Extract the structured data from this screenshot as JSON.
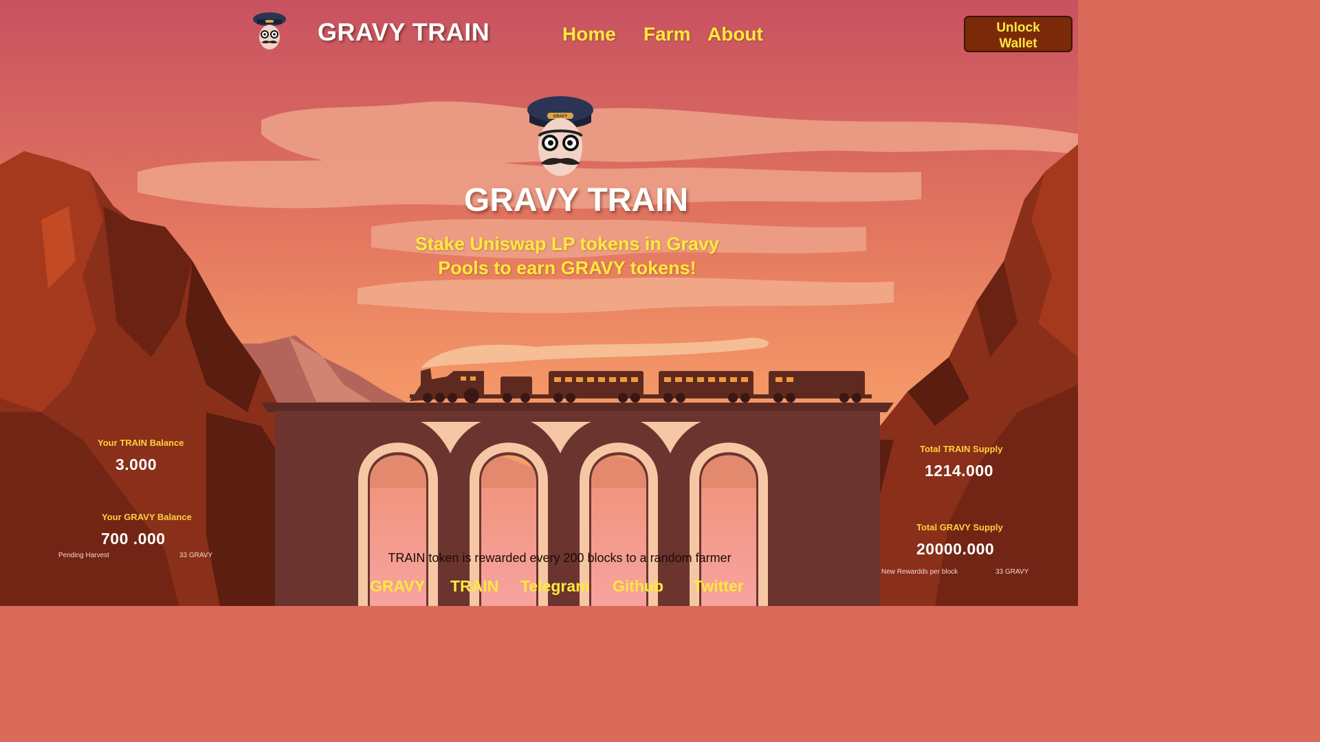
{
  "header": {
    "brand": "GRAVY TRAIN",
    "nav": {
      "home": "Home",
      "farm": "Farm",
      "about": "About"
    },
    "unlock_line1": "Unlock",
    "unlock_line2": "Wallet"
  },
  "hero": {
    "cap_badge": "GRAVY",
    "title": "GRAVY TRAIN",
    "subtitle_line1": "Stake Uniswap LP tokens in Gravy",
    "subtitle_line2": "Pools to earn GRAVY tokens!"
  },
  "left_stats": {
    "train_label": "Your TRAIN Balance",
    "train_value": "3.000",
    "gravy_label": "Your GRAVY Balance",
    "gravy_value": "700 .000",
    "pending_label": "Pending Harvest",
    "pending_value": "33 GRAVY"
  },
  "right_stats": {
    "train_supply_label": "Total  TRAIN Supply",
    "train_supply_value": "1214.000",
    "gravy_supply_label": "Total GRAVY Supply",
    "gravy_supply_value": "20000.000",
    "rewards_label": "New Rewardds per block",
    "rewards_value": "33 GRAVY"
  },
  "footer": {
    "note": "TRAIN token is rewarded every 200 blocks to a random farmer",
    "links": {
      "gravy": "GRAVY",
      "train": "TRAIN",
      "telegram": "Telegram",
      "github": "Github",
      "twitter": "Twitter"
    }
  },
  "colors": {
    "accent_yellow": "#ffe93c",
    "label_gold": "#ffd23a",
    "button_bg": "#7a2a08",
    "sky_top": "#c95a5f",
    "sky_bottom": "#f3b98e",
    "bridge": "#6b342e"
  },
  "icons": {
    "logo": "conductor-mascot-icon",
    "hero": "conductor-mascot-icon"
  }
}
